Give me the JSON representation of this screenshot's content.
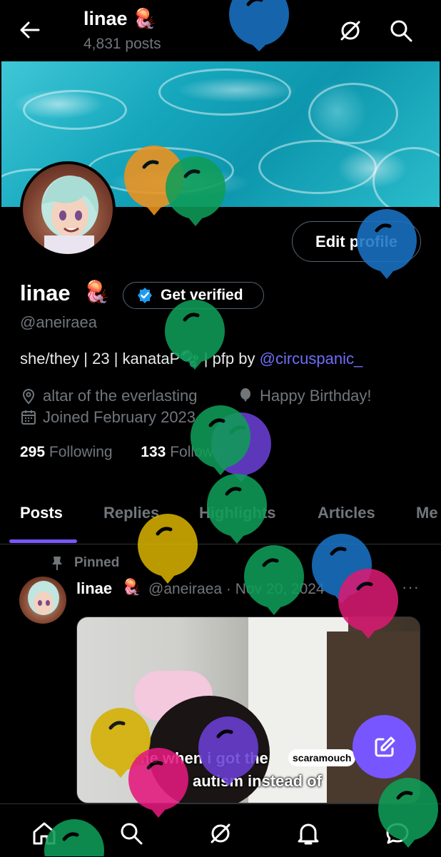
{
  "header": {
    "display_name": "linae",
    "name_emoji": "🪼",
    "posts_count": "4,831 posts"
  },
  "profile": {
    "edit_label": "Edit profile",
    "display_name": "linae",
    "name_emoji": "🪼",
    "verified_label": "Get verified",
    "handle": "@aneiraea",
    "bio_text": "she/they | 23 | kanataP🫧 | pfp by ",
    "bio_link": "@circuspanic_",
    "location": "altar of the everlasting",
    "birthday": "Happy Birthday!",
    "joined": "Joined February 2023",
    "following_count": "295",
    "following_label": "Following",
    "followers_count": "133",
    "followers_label": "Followers"
  },
  "tabs": [
    {
      "label": "Posts"
    },
    {
      "label": "Replies"
    },
    {
      "label": "Highlights"
    },
    {
      "label": "Articles"
    },
    {
      "label": "Me"
    }
  ],
  "post": {
    "pinned_label": "Pinned",
    "name": "linae",
    "name_emoji": "🪼",
    "handle_date": "@aneiraea · Nov 20, 2024",
    "more": "···",
    "caption_line1": "me when i got the",
    "caption_bubble": "scaramouch",
    "caption_line2": "autism instead of"
  },
  "icons": {
    "back": "arrow-left-icon",
    "grok": "grok-icon",
    "search": "search-icon",
    "verified": "verified-badge-icon",
    "location": "location-pin-icon",
    "balloon": "balloon-icon",
    "calendar": "calendar-icon",
    "pin": "pin-icon",
    "compose": "compose-icon",
    "home": "home-icon",
    "bell": "bell-icon",
    "messages": "message-icon"
  },
  "colors": {
    "background": "#000000",
    "accent": "#7856ff",
    "link": "#6e6efa",
    "secondary_text": "#71767b",
    "verified_blue": "#1d9bf0"
  }
}
